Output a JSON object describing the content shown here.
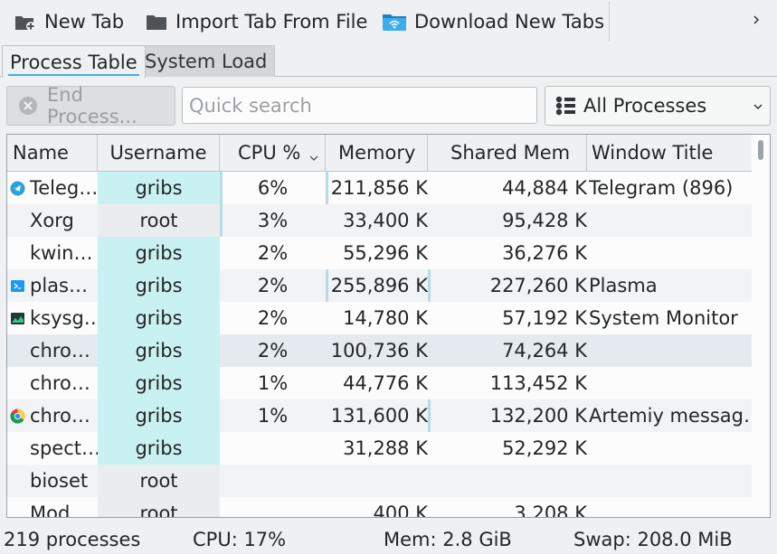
{
  "toolbar": {
    "new_tab": "New Tab",
    "import_tab": "Import Tab From File",
    "download_tabs": "Download New Tabs",
    "icons": [
      "new-tab-icon",
      "folder-icon",
      "download-folder-icon",
      "chevron-right-icon"
    ]
  },
  "tabs": [
    {
      "label": "Process Table",
      "active": true
    },
    {
      "label": "System Load",
      "active": false
    }
  ],
  "controls": {
    "end_process_label": "End Process...",
    "search_placeholder": "Quick search",
    "filter_value": "All Processes"
  },
  "table": {
    "columns": [
      "Name",
      "Username",
      "CPU %",
      "Memory",
      "Shared Mem",
      "Window Title"
    ],
    "sorted_column": "CPU %",
    "rows": [
      {
        "name": "Teleg…",
        "icon": "telegram-icon",
        "user": "gribs",
        "cpu": "6%",
        "mem": "211,856 K",
        "shared": "44,884 K",
        "window": "Telegram (896)"
      },
      {
        "name": "Xorg",
        "icon": "",
        "user": "root",
        "cpu": "3%",
        "mem": "33,400 K",
        "shared": "95,428 K",
        "window": ""
      },
      {
        "name": "kwin…",
        "icon": "",
        "user": "gribs",
        "cpu": "2%",
        "mem": "55,296 K",
        "shared": "36,276 K",
        "window": ""
      },
      {
        "name": "plas…",
        "icon": "plasma-icon",
        "user": "gribs",
        "cpu": "2%",
        "mem": "255,896 K",
        "shared": "227,260 K",
        "window": "Plasma"
      },
      {
        "name": "ksysg…",
        "icon": "system-monitor-icon",
        "user": "gribs",
        "cpu": "2%",
        "mem": "14,780 K",
        "shared": "57,192 K",
        "window": "System Monitor"
      },
      {
        "name": "chro…",
        "icon": "",
        "user": "gribs",
        "cpu": "2%",
        "mem": "100,736 K",
        "shared": "74,264 K",
        "window": ""
      },
      {
        "name": "chro…",
        "icon": "",
        "user": "gribs",
        "cpu": "1%",
        "mem": "44,776 K",
        "shared": "113,452 K",
        "window": ""
      },
      {
        "name": "chro…",
        "icon": "chrome-icon",
        "user": "gribs",
        "cpu": "1%",
        "mem": "131,600 K",
        "shared": "132,200 K",
        "window": "Artemiy messag…"
      },
      {
        "name": "spect…",
        "icon": "",
        "user": "gribs",
        "cpu": "",
        "mem": "31,288 K",
        "shared": "52,292 K",
        "window": ""
      },
      {
        "name": "bioset",
        "icon": "",
        "user": "root",
        "cpu": "",
        "mem": "",
        "shared": "",
        "window": ""
      },
      {
        "name": "Mod",
        "icon": "",
        "user": "root",
        "cpu": "",
        "mem": "400 K",
        "shared": "3,208 K",
        "window": ""
      }
    ]
  },
  "status": {
    "processes": "219 processes",
    "cpu": "CPU: 17%",
    "mem": "Mem: 2.8 GiB",
    "swap": "Swap: 208.0 MiB"
  },
  "colors": {
    "accent": "#3daee9",
    "user_highlight": "#c9f1f1",
    "root_highlight": "#ebeced",
    "selected_row": "#e4eaf0",
    "alt_row": "#f2f3f4"
  }
}
